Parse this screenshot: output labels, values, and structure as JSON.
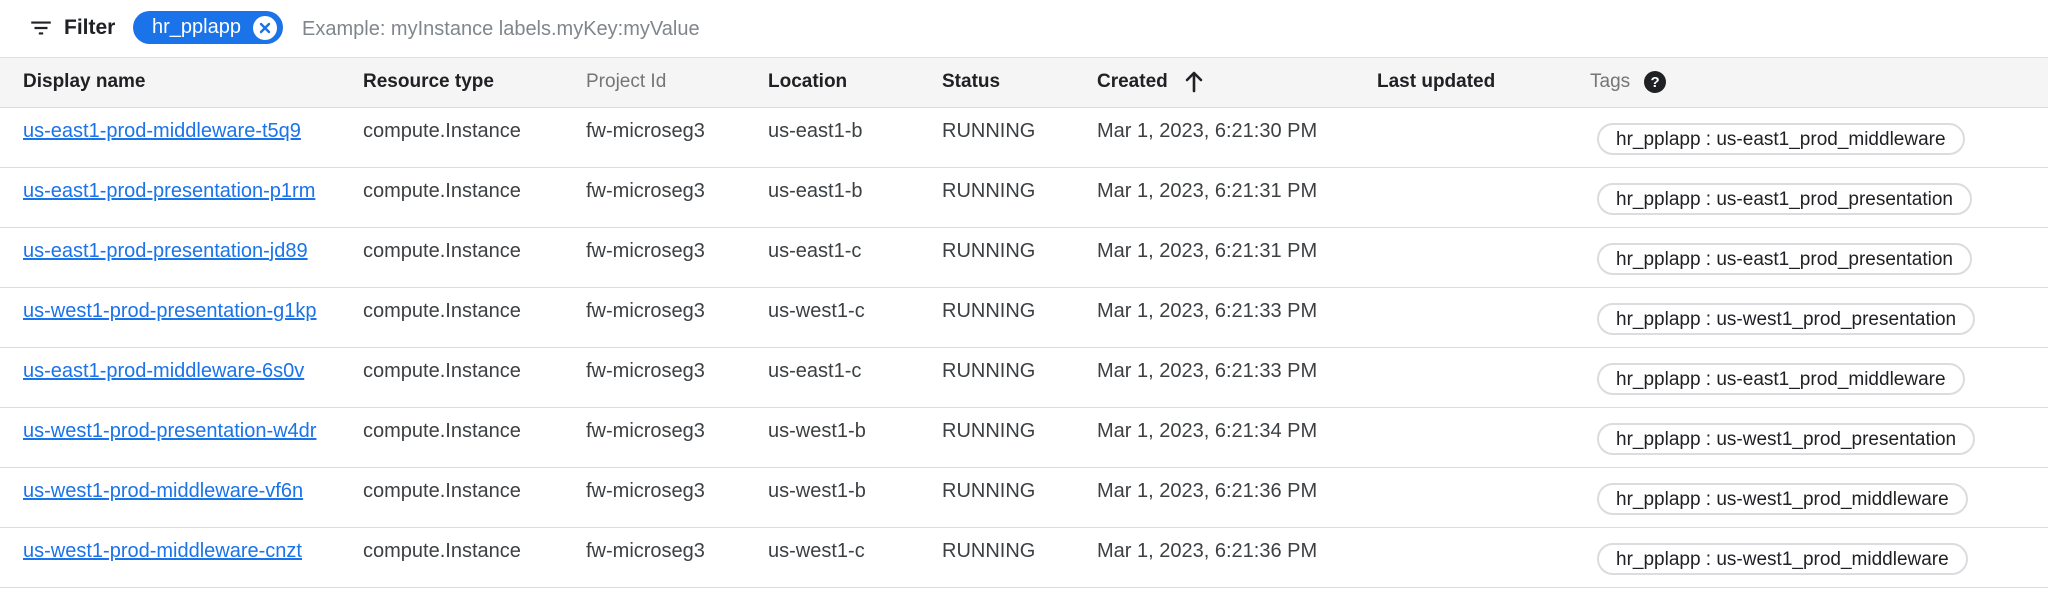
{
  "filter": {
    "button_label": "Filter",
    "chip_label": "hr_pplapp",
    "placeholder": "Example: myInstance labels.myKey:myValue"
  },
  "columns": {
    "display_name": "Display name",
    "resource_type": "Resource type",
    "project_id": "Project Id",
    "location": "Location",
    "status": "Status",
    "created": "Created",
    "last_updated": "Last updated",
    "tags": "Tags"
  },
  "sort": {
    "column": "created",
    "direction": "ascending",
    "icon": "arrow-upward-icon"
  },
  "rows": [
    {
      "name": "us-east1-prod-middleware-t5q9",
      "type": "compute.Instance",
      "project": "fw-microseg3",
      "location": "us-east1-b",
      "status": "RUNNING",
      "created": "Mar 1, 2023, 6:21:30 PM",
      "updated": "",
      "tag": "hr_pplapp : us-east1_prod_middleware"
    },
    {
      "name": "us-east1-prod-presentation-p1rm",
      "type": "compute.Instance",
      "project": "fw-microseg3",
      "location": "us-east1-b",
      "status": "RUNNING",
      "created": "Mar 1, 2023, 6:21:31 PM",
      "updated": "",
      "tag": "hr_pplapp : us-east1_prod_presentation"
    },
    {
      "name": "us-east1-prod-presentation-jd89",
      "type": "compute.Instance",
      "project": "fw-microseg3",
      "location": "us-east1-c",
      "status": "RUNNING",
      "created": "Mar 1, 2023, 6:21:31 PM",
      "updated": "",
      "tag": "hr_pplapp : us-east1_prod_presentation"
    },
    {
      "name": "us-west1-prod-presentation-g1kp",
      "type": "compute.Instance",
      "project": "fw-microseg3",
      "location": "us-west1-c",
      "status": "RUNNING",
      "created": "Mar 1, 2023, 6:21:33 PM",
      "updated": "",
      "tag": "hr_pplapp : us-west1_prod_presentation"
    },
    {
      "name": "us-east1-prod-middleware-6s0v",
      "type": "compute.Instance",
      "project": "fw-microseg3",
      "location": "us-east1-c",
      "status": "RUNNING",
      "created": "Mar 1, 2023, 6:21:33 PM",
      "updated": "",
      "tag": "hr_pplapp : us-east1_prod_middleware"
    },
    {
      "name": "us-west1-prod-presentation-w4dr",
      "type": "compute.Instance",
      "project": "fw-microseg3",
      "location": "us-west1-b",
      "status": "RUNNING",
      "created": "Mar 1, 2023, 6:21:34 PM",
      "updated": "",
      "tag": "hr_pplapp : us-west1_prod_presentation"
    },
    {
      "name": "us-west1-prod-middleware-vf6n",
      "type": "compute.Instance",
      "project": "fw-microseg3",
      "location": "us-west1-b",
      "status": "RUNNING",
      "created": "Mar 1, 2023, 6:21:36 PM",
      "updated": "",
      "tag": "hr_pplapp : us-west1_prod_middleware"
    },
    {
      "name": "us-west1-prod-middleware-cnzt",
      "type": "compute.Instance",
      "project": "fw-microseg3",
      "location": "us-west1-c",
      "status": "RUNNING",
      "created": "Mar 1, 2023, 6:21:36 PM",
      "updated": "",
      "tag": "hr_pplapp : us-west1_prod_middleware"
    }
  ],
  "colors": {
    "accent": "#1a73e8",
    "header_bg": "#f5f5f5",
    "divider": "#dadce0",
    "muted_text": "#757575"
  }
}
